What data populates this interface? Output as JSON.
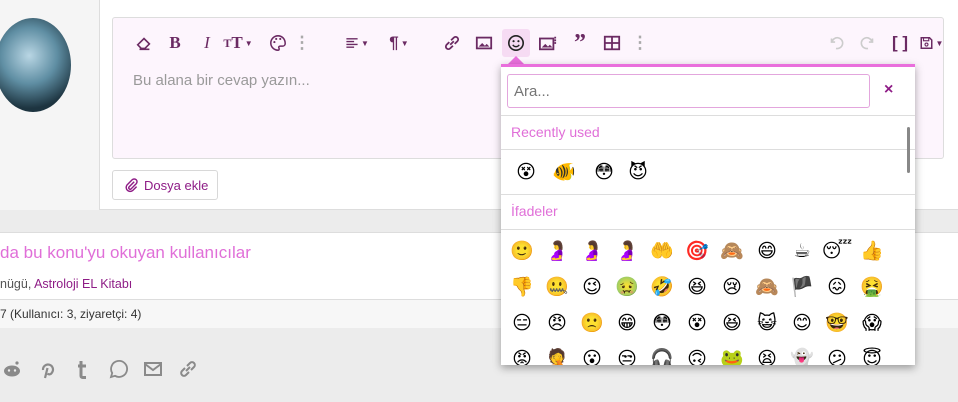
{
  "editor": {
    "placeholder": "Bu alana bir cevap yazın...",
    "toolbar": [
      "eraser-icon",
      "bold-icon",
      "italic-icon",
      "text-size-icon",
      "palette-icon",
      "more-icon",
      "align-icon",
      "paragraph-icon",
      "link-icon",
      "image-icon",
      "smiley-icon",
      "media-icon",
      "quote-icon",
      "table-icon",
      "more-icon",
      "undo-icon",
      "redo-icon",
      "bbcode-icon",
      "save-draft-icon"
    ],
    "attach_label": "Dosya ekle"
  },
  "emoji_popup": {
    "search_placeholder": "Ara...",
    "close": "×",
    "recent_title": "Recently used",
    "recent": [
      "😵",
      "🐠",
      "😳",
      "😈"
    ],
    "section_title": "İfadeler",
    "items": [
      "🙂",
      "🤰",
      "🤰",
      "🤰",
      "🤲",
      "🎯",
      "🙈",
      "😄",
      "☕",
      "😴",
      "👍",
      "👎",
      "🤐",
      "😉",
      "🤢",
      "🤣",
      "😆",
      "😢",
      "🙈",
      "🏴",
      "😖",
      "🤮",
      "😑",
      "😠",
      "🙁",
      "😁",
      "😳",
      "😵",
      "😆",
      "😺",
      "😊",
      "🤓",
      "😱",
      "😡",
      "🤦",
      "😮",
      "😒",
      "🎧",
      "🙃",
      "🐸",
      "😫",
      "👻",
      "😕",
      "😇"
    ]
  },
  "readers": {
    "title": "da bu konu'yu okuyan kullanıcılar",
    "users_prefix": "nügü",
    "users_sep": ", ",
    "user_link": "Astroloji EL Kitabı",
    "count": "7 (Kullanıcı: 3, ziyaretçi: 4)"
  },
  "share": [
    "reddit-icon",
    "pinterest-icon",
    "tumblr-icon",
    "whatsapp-icon",
    "email-icon",
    "link-icon"
  ]
}
